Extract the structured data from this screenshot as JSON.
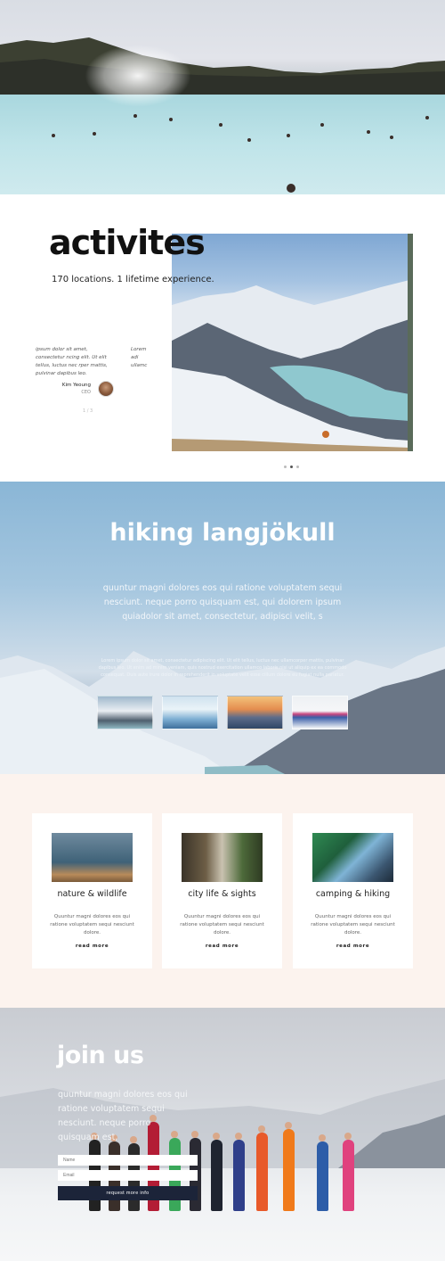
{
  "hero": {
    "image": "blue-lagoon-hot-spring-photo"
  },
  "activities": {
    "title": "activites",
    "subtitle": "170 locations. 1 lifetime experience.",
    "testimonial": {
      "text": "ipsum dolor sit amet, consectetur ncing elit. Ut elit tellus, luctus nec rper mattis, pulvinar dapibus leo.",
      "text_next": "Lorem adi ullamc",
      "name": "Kim Yeoung",
      "role": "CEO",
      "pagination": "1 / 3"
    },
    "image": "snowy-mountain-valley-photo"
  },
  "hiking": {
    "title": "hiking langjökull",
    "body": "quuntur magni dolores eos qui ratione voluptatem sequi nesciunt. neque porro quisquam est, qui dolorem ipsum quiadolor sit amet, consectetur, adipisci velit, s",
    "small_text": "Lorem ipsum dolor sit amet, consectetur adipiscing elit. Ut elit tellus, luctus nec ullamcorper mattis, pulvinar dapibus leo. Ut enim ad minim veniam, quis nostrud exercitation ullamco laboris nisi ut aliquip ex ea commodo consequat. Duis aute irure dolor in reprehenderit in voluptate velit esse cillum dolore eu fugiat nulla pariatur.",
    "thumbnails": [
      "glacier-lagoon-thumbnail",
      "ice-floes-thumbnail",
      "sunset-iceberg-thumbnail",
      "group-on-snow-thumbnail"
    ]
  },
  "categories": [
    {
      "title": "nature & wildlife",
      "text": "Quuntur magni dolores eos qui ratione voluptatem sequi nesciunt dolore.",
      "link": "read more",
      "image": "puffin-photo"
    },
    {
      "title": "city life & sights",
      "text": "Quuntur magni dolores eos qui ratione voluptatem sequi nesciunt dolore.",
      "link": "read more",
      "image": "city-street-photo"
    },
    {
      "title": "camping & hiking",
      "text": "Quuntur magni dolores eos qui ratione voluptatem sequi nesciunt dolore.",
      "link": "read more",
      "image": "tent-view-photo"
    }
  ],
  "join": {
    "title": "join us",
    "body": "quuntur magni dolores eos qui ratione voluptatem sequi nesciunt. neque porro quisquam est,",
    "name_placeholder": "Name",
    "email_placeholder": "Email",
    "button": "request more info",
    "image": "group-of-climbers-photo"
  },
  "colors": {
    "accent_dark": "#1c2439",
    "section_bg": "#fcf3ee"
  }
}
